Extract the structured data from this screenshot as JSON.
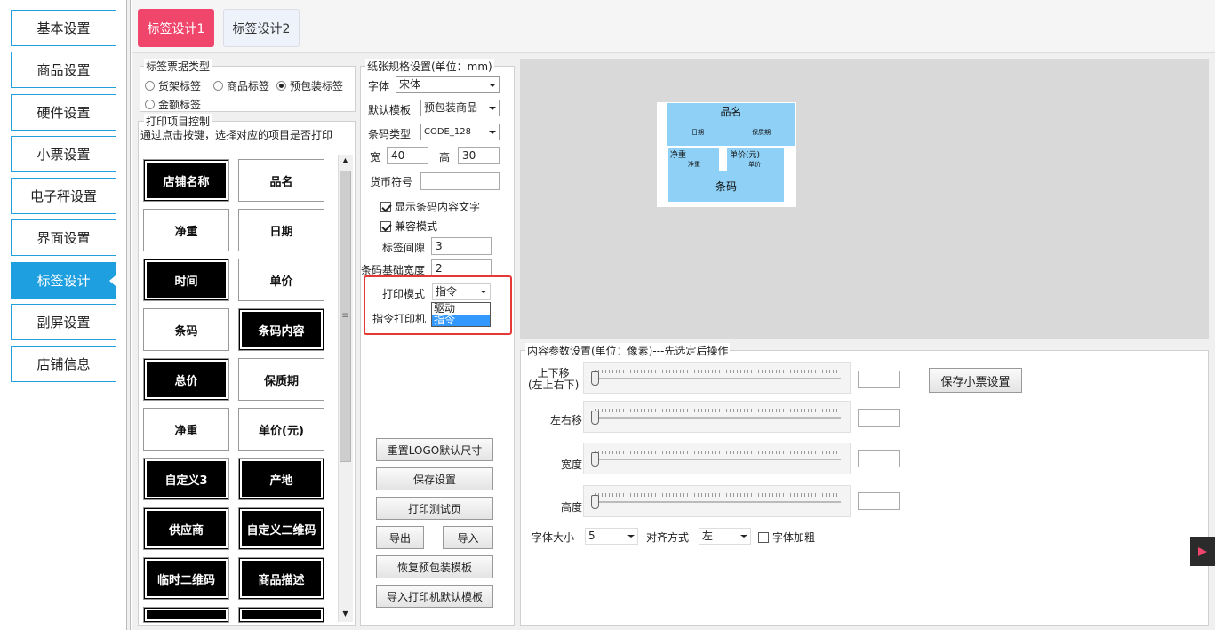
{
  "nav": {
    "items": [
      "基本设置",
      "商品设置",
      "硬件设置",
      "小票设置",
      "电子秤设置",
      "界面设置",
      "标签设计",
      "副屏设置",
      "店铺信息"
    ],
    "active_index": 6
  },
  "tabs": [
    "标签设计1",
    "标签设计2"
  ],
  "ticket_type": {
    "title": "标签票据类型",
    "options": [
      "货架标签",
      "商品标签",
      "预包装标签",
      "金额标签"
    ],
    "selected": "预包装标签"
  },
  "print_items": {
    "title": "打印项目控制",
    "hint": "通过点击按键，选择对应的项目是否打印",
    "buttons": [
      {
        "label": "店铺名称",
        "on": true
      },
      {
        "label": "品名",
        "on": false
      },
      {
        "label": "净重",
        "on": false
      },
      {
        "label": "日期",
        "on": false
      },
      {
        "label": "时间",
        "on": true
      },
      {
        "label": "单价",
        "on": false
      },
      {
        "label": "条码",
        "on": false
      },
      {
        "label": "条码内容",
        "on": true
      },
      {
        "label": "总价",
        "on": true
      },
      {
        "label": "保质期",
        "on": false
      },
      {
        "label": "净重",
        "on": false
      },
      {
        "label": "单价(元)",
        "on": false
      },
      {
        "label": "自定义3",
        "on": true
      },
      {
        "label": "产地",
        "on": true
      },
      {
        "label": "供应商",
        "on": true
      },
      {
        "label": "自定义二维码",
        "on": true
      },
      {
        "label": "临时二维码",
        "on": true
      },
      {
        "label": "商品描述",
        "on": true
      }
    ]
  },
  "paper": {
    "title": "纸张规格设置(单位：mm)",
    "font_label": "字体",
    "font_value": "宋体",
    "template_label": "默认模板",
    "template_value": "预包装商品",
    "barcode_type_label": "条码类型",
    "barcode_type_value": "CODE_128",
    "width_label": "宽",
    "width_value": "40",
    "height_label": "高",
    "height_value": "30",
    "currency_label": "货币符号",
    "currency_value": "",
    "show_barcode_text": "显示条码内容文字",
    "compat_mode": "兼容模式",
    "gap_label": "标签间隙",
    "gap_value": "3",
    "barcode_width_label": "条码基础宽度",
    "barcode_width_value": "2",
    "print_mode_label": "打印模式",
    "print_mode_value": "指令",
    "print_mode_options": [
      "驱动",
      "指令"
    ],
    "cmd_printer_label": "指令打印机",
    "buttons": [
      "重置LOGO默认尺寸",
      "保存设置",
      "打印测试页",
      "导出",
      "导入",
      "恢复预包装模板",
      "导入打印机默认模板"
    ]
  },
  "preview": {
    "name": "品名",
    "date": "日期",
    "shelf": "保质期",
    "weight_t": "净重",
    "weight_s": "净重",
    "price_t": "单价(元)",
    "price_s": "单价",
    "barcode": "条码"
  },
  "params": {
    "title": "内容参数设置(单位：像素)---先选定后操作",
    "updown_label": "上下移\n(左上右下)",
    "leftright_label": "左右移",
    "width_label": "宽度",
    "height_label": "高度",
    "save_button": "保存小票设置",
    "font_size_label": "字体大小",
    "font_size_value": "5",
    "align_label": "对齐方式",
    "align_value": "左",
    "bold_label": "字体加粗"
  },
  "colors": {
    "accent": "#1e9fe0",
    "tab_active": "#f0466c",
    "label_fill": "#8fd0f7",
    "highlight": "#e53935"
  }
}
